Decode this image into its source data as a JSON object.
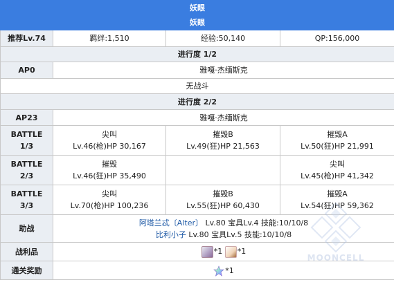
{
  "header": {
    "title": "妖眼",
    "subtitle": "妖眼"
  },
  "rec": {
    "label": "推荐Lv.74",
    "bond": "羁绊:1,510",
    "exp": "经验:50,140",
    "qp": "QP:156,000"
  },
  "progress1": {
    "label": "进行度 1/2",
    "ap_label": "AP0",
    "location": "雅嘎·杰缅斯克",
    "no_battle": "无战斗"
  },
  "progress2": {
    "label": "进行度 2/2",
    "ap_label": "AP23",
    "location": "雅嘎·杰缅斯克"
  },
  "battles": [
    {
      "label_top": "BATTLE",
      "label_bottom": "1/3",
      "enemies": [
        {
          "name": "尖叫",
          "stats": "Lv.46(枪)HP 30,167"
        },
        {
          "name": "摧毁B",
          "stats": "Lv.49(狂)HP 21,563"
        },
        {
          "name": "摧毁A",
          "stats": "Lv.50(狂)HP 21,991"
        }
      ]
    },
    {
      "label_top": "BATTLE",
      "label_bottom": "2/3",
      "enemies": [
        {
          "name": "摧毁",
          "stats": "Lv.46(狂)HP 35,490"
        },
        {
          "name": "",
          "stats": ""
        },
        {
          "name": "尖叫",
          "stats": "Lv.45(枪)HP 41,342"
        }
      ]
    },
    {
      "label_top": "BATTLE",
      "label_bottom": "3/3",
      "enemies": [
        {
          "name": "尖叫",
          "stats": "Lv.70(枪)HP 100,236"
        },
        {
          "name": "摧毁B",
          "stats": "Lv.55(狂)HP 60,430"
        },
        {
          "name": "摧毁A",
          "stats": "Lv.54(狂)HP 59,362"
        }
      ]
    }
  ],
  "support": {
    "label": "助战",
    "s1_name": "阿塔兰忒〔Alter〕",
    "s1_stats": " Lv.80 宝具Lv.4 技能:10/10/8",
    "s2_name": "比利小子",
    "s2_stats": " Lv.80 宝具Lv.5 技能:10/10/8"
  },
  "drops": {
    "label": "战利品",
    "item1_count": "*1",
    "item2_count": "*1",
    "item1_icon": "bone-material-icon",
    "item2_icon": "feather-material-icon"
  },
  "clear": {
    "label": "通关奖励",
    "count": "*1",
    "icon": "saint-quartz-icon"
  },
  "watermark": {
    "text": "MOONCELL"
  },
  "colors": {
    "header": "#3a7de0",
    "label_bg": "#eaeef3",
    "link": "#1f5aa6"
  }
}
